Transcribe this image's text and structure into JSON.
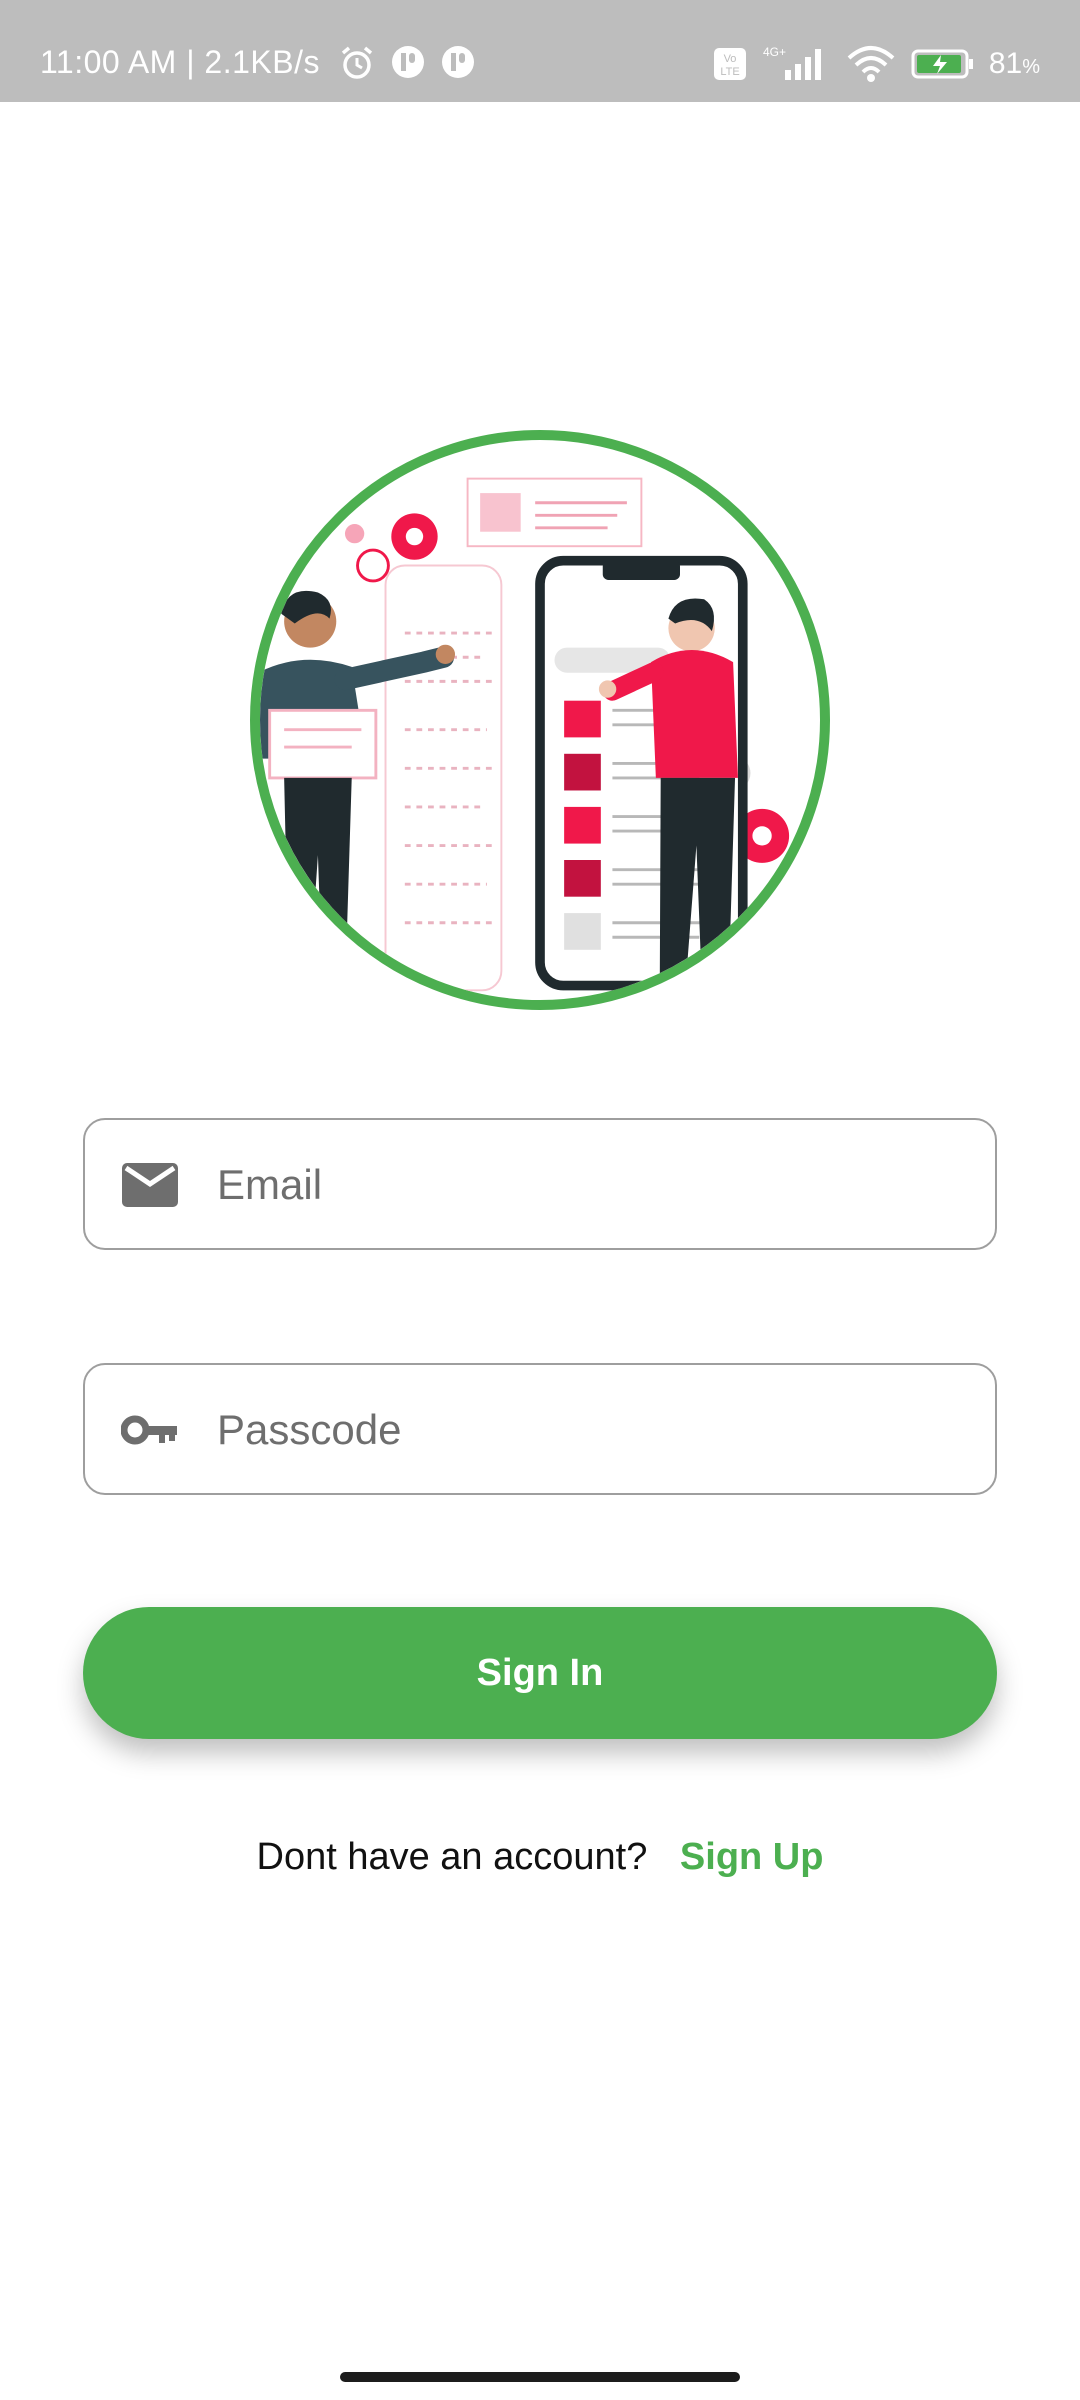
{
  "status_bar": {
    "time": "11:00 AM | 2.1KB/s",
    "battery_percent": "81",
    "battery_symbol": "%",
    "network": "4G+"
  },
  "login": {
    "email_placeholder": "Email",
    "passcode_placeholder": "Passcode",
    "signin_label": "Sign In",
    "no_account_text": "Dont have an account?",
    "signup_label": "Sign Up"
  },
  "icons": {
    "email": "mail-icon",
    "passcode": "key-icon"
  },
  "colors": {
    "accent": "#4caf50",
    "status_bar_bg": "#bdbdbd",
    "illustration_red": "#f0184a"
  }
}
